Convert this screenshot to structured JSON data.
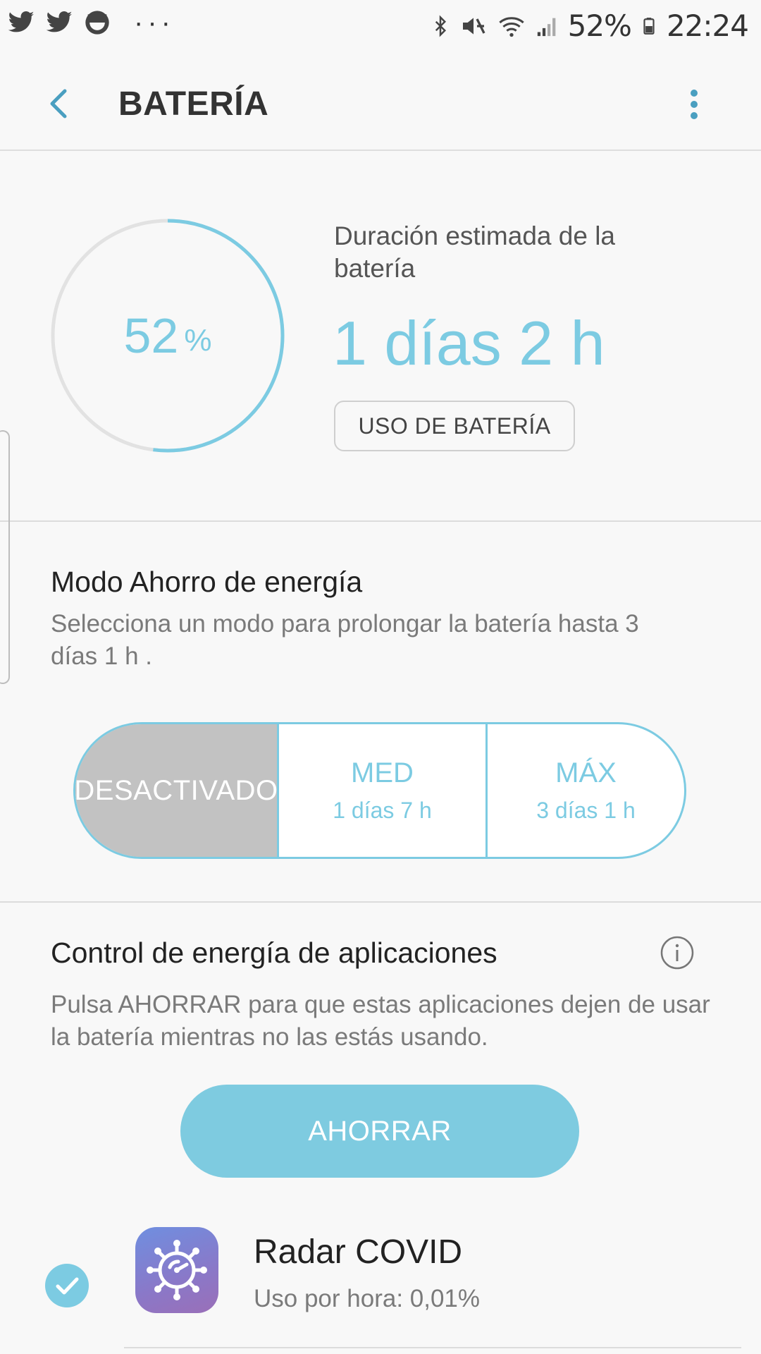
{
  "status_bar": {
    "notification_icons": [
      "twitter-icon",
      "twitter-icon",
      "smiley-notification-icon"
    ],
    "more_notifications": "···",
    "system_icons": [
      "bluetooth-icon",
      "vibrate-mute-icon",
      "wifi-icon",
      "signal-icon",
      "battery-icon"
    ],
    "battery_percent": "52%",
    "time": "22:24"
  },
  "app_bar": {
    "title": "BATERÍA"
  },
  "battery": {
    "level_fraction": 0.52,
    "level_value": "52",
    "level_unit": "%",
    "estimate_label": "Duración estimada de la batería",
    "estimate_value": "1 días 2 h",
    "usage_button": "USO DE BATERÍA"
  },
  "power_saving": {
    "title": "Modo Ahorro de energía",
    "description": "Selecciona un modo para prolongar la batería hasta 3 días 1 h .",
    "modes": [
      {
        "label": "DESACTIVADO",
        "sub": "",
        "selected": true
      },
      {
        "label": "MED",
        "sub": "1 días 7 h",
        "selected": false
      },
      {
        "label": "MÁX",
        "sub": "3 días 1 h",
        "selected": false
      }
    ]
  },
  "app_power": {
    "title": "Control de energía de aplicaciones",
    "description": "Pulsa AHORRAR para que estas aplicaciones dejen de usar la batería mientras no las estás usando.",
    "save_button": "AHORRAR",
    "apps": [
      {
        "name": "Radar COVID",
        "usage": "Uso por hora: 0,01%",
        "checked": true
      }
    ]
  },
  "colors": {
    "accent": "#7ccbe2",
    "accent_dark": "#4a9fc0",
    "selected_segment": "#c2c2c2",
    "ring_track": "#e2e2e2"
  }
}
